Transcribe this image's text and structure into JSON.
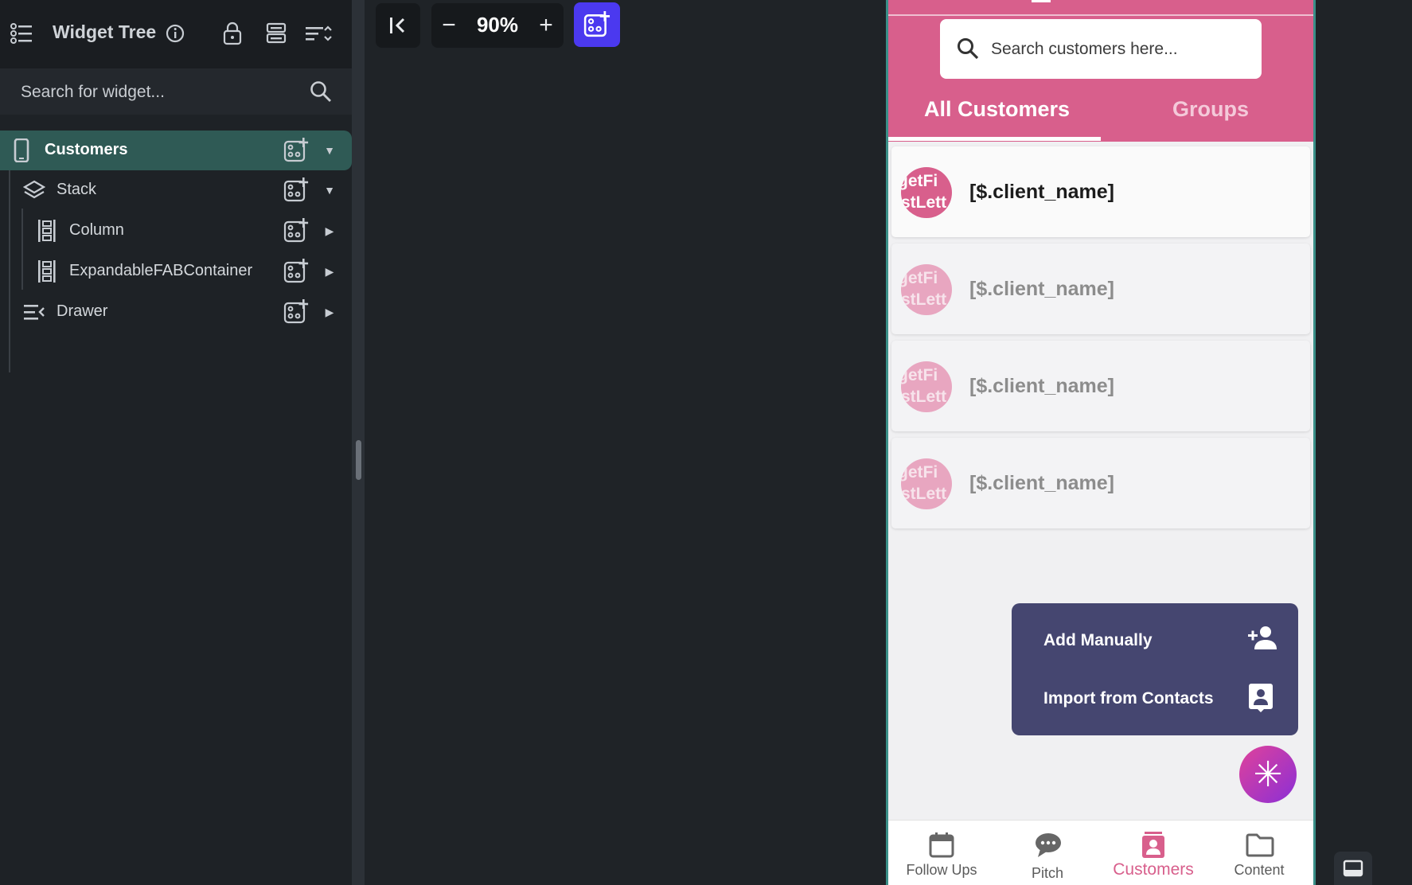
{
  "left_panel": {
    "title": "Widget Tree",
    "search_placeholder": "Search for widget...",
    "header_icons": [
      "list-tree-icon",
      "info-icon",
      "lock-icon",
      "storage-icon",
      "sort-toggle-icon"
    ],
    "tree": [
      {
        "label": "Customers",
        "icon": "phone-icon",
        "selected": true,
        "expanded": true,
        "level": 0
      },
      {
        "label": "Stack",
        "icon": "layers-icon",
        "expanded": true,
        "level": 1
      },
      {
        "label": "Column",
        "icon": "column-icon",
        "expanded": false,
        "level": 2
      },
      {
        "label": "ExpandableFABContainer",
        "icon": "column-icon",
        "expanded": false,
        "level": 2
      },
      {
        "label": "Drawer",
        "icon": "drawer-icon",
        "expanded": false,
        "level": 1
      }
    ]
  },
  "toolbar": {
    "zoom_label": "90%",
    "zoom_out": "−",
    "zoom_in": "+"
  },
  "phone": {
    "search_placeholder": "Search customers here...",
    "tabs": [
      {
        "label": "All Customers",
        "active": true
      },
      {
        "label": "Groups",
        "active": false
      }
    ],
    "customers": [
      {
        "avatar_text": "getFi\nstLett",
        "name": "[$.client_name]"
      },
      {
        "avatar_text": "getFi\nstLett",
        "name": "[$.client_name]"
      },
      {
        "avatar_text": "getFi\nstLett",
        "name": "[$.client_name]"
      },
      {
        "avatar_text": "getFi\nstLett",
        "name": "[$.client_name]"
      }
    ],
    "fab_menu": [
      {
        "label": "Add Manually",
        "icon": "person-add-icon"
      },
      {
        "label": "Import from Contacts",
        "icon": "contact-card-icon"
      }
    ],
    "fab_symbol": "✳",
    "bottom_nav": [
      {
        "label": "Follow Ups",
        "icon": "calendar-icon",
        "active": false
      },
      {
        "label": "Pitch",
        "icon": "chat-icon",
        "active": false
      },
      {
        "label": "Customers",
        "icon": "contacts-icon",
        "active": true
      },
      {
        "label": "Content",
        "icon": "folder-icon",
        "active": false
      }
    ]
  },
  "colors": {
    "primary_pink": "#d85f8c",
    "selected_row": "#2f5a55",
    "fab_menu_bg": "#454670",
    "accent_blue": "#4b39ef"
  }
}
